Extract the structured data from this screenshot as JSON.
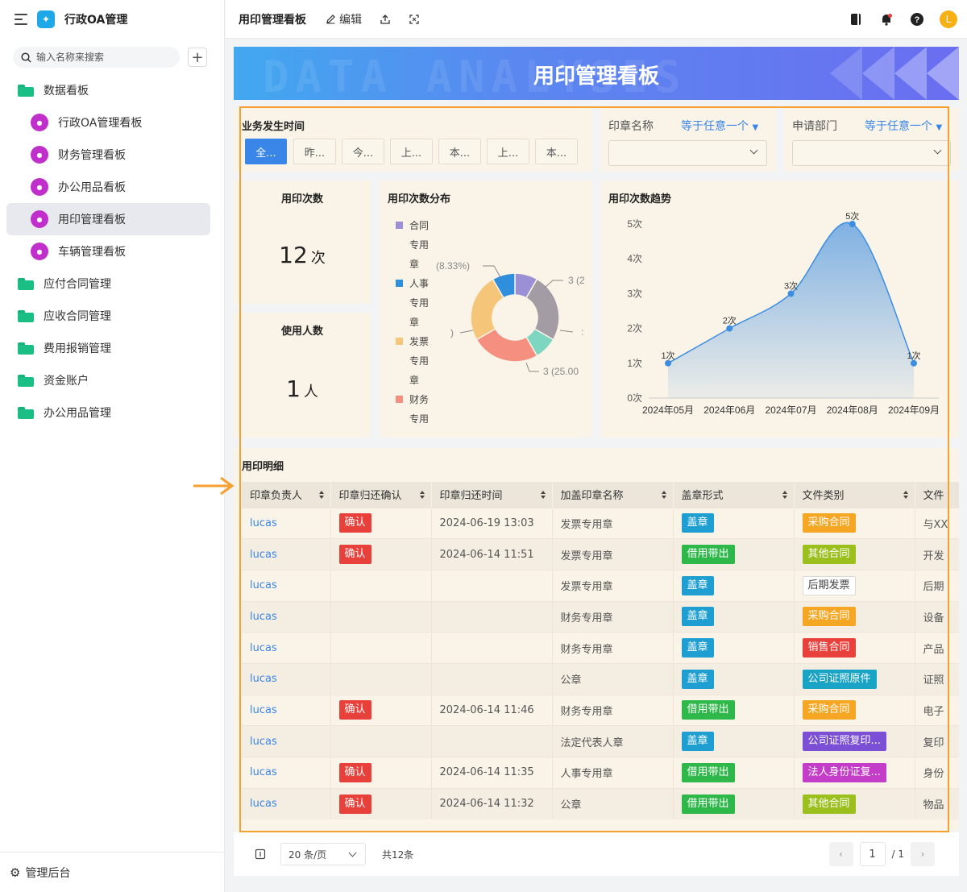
{
  "app": {
    "title": "行政OA管理"
  },
  "sidebar": {
    "search_placeholder": "输入名称来搜索",
    "items": [
      {
        "label": "数据看板",
        "type": "folder",
        "level": 0
      },
      {
        "label": "行政OA管理看板",
        "type": "page",
        "level": 1
      },
      {
        "label": "财务管理看板",
        "type": "page",
        "level": 1
      },
      {
        "label": "办公用品看板",
        "type": "page",
        "level": 1
      },
      {
        "label": "用印管理看板",
        "type": "page",
        "level": 1,
        "active": true
      },
      {
        "label": "车辆管理看板",
        "type": "page",
        "level": 1
      },
      {
        "label": "应付合同管理",
        "type": "folder",
        "level": 0
      },
      {
        "label": "应收合同管理",
        "type": "folder",
        "level": 0
      },
      {
        "label": "费用报销管理",
        "type": "folder",
        "level": 0
      },
      {
        "label": "资金账户",
        "type": "folder",
        "level": 0
      },
      {
        "label": "办公用品管理",
        "type": "folder",
        "level": 0
      }
    ],
    "footer_label": "管理后台"
  },
  "topbar": {
    "page_title": "用印管理看板",
    "edit_label": "编辑",
    "avatar_letter": "L"
  },
  "banner": {
    "title": "用印管理看板",
    "bg_text": "DATA ANALYSIS"
  },
  "filters": {
    "time_title": "业务发生时间",
    "time_buttons": [
      "全...",
      "昨...",
      "今...",
      "上...",
      "本...",
      "上...",
      "本..."
    ],
    "seal_label": "印章名称",
    "seal_op": "等于任意一个",
    "dept_label": "申请部门",
    "dept_op": "等于任意一个"
  },
  "kpi": {
    "count_title": "用印次数",
    "count_value": "12",
    "count_unit": "次",
    "users_title": "使用人数",
    "users_value": "1",
    "users_unit": "人"
  },
  "pie": {
    "title": "用印次数分布",
    "legend": [
      {
        "label": "合同专用章",
        "color": "#9b8fd6"
      },
      {
        "label": "人事专用章",
        "color": "#2f8fdc"
      },
      {
        "label": "发票专用章",
        "color": "#f5c57a"
      },
      {
        "label": "财务专用章",
        "color": "#f58f7f"
      }
    ],
    "labels": {
      "pct_left": "(8.33%)",
      "top_right": "3 (2",
      "right": ":",
      "left": ")",
      "bottom": "3 (25.00"
    }
  },
  "trend": {
    "title": "用印次数趋势"
  },
  "chart_data": {
    "type": "area",
    "title": "用印次数趋势",
    "categories": [
      "2024年05月",
      "2024年06月",
      "2024年07月",
      "2024年08月",
      "2024年09月"
    ],
    "values": [
      1,
      2,
      3,
      5,
      1
    ],
    "value_labels": [
      "1次",
      "2次",
      "3次",
      "5次",
      "1次"
    ],
    "yticks": [
      "0次",
      "1次",
      "2次",
      "3次",
      "4次",
      "5次"
    ],
    "ylim": [
      0,
      5
    ],
    "color": "#3d8de0"
  },
  "pie_data": {
    "type": "pie",
    "slices": [
      {
        "name": "合同专用章",
        "value": 1,
        "color": "#9b8fd6"
      },
      {
        "name": "",
        "value": 3,
        "color": "#a39ca5"
      },
      {
        "name": "",
        "value": 1,
        "color": "#7dd6c0"
      },
      {
        "name": "",
        "value": 3,
        "color": "#f58f7f"
      },
      {
        "name": "发票专用章",
        "value": 3,
        "color": "#f5c57a"
      },
      {
        "name": "人事专用章",
        "value": 1,
        "color": "#2f8fdc"
      }
    ]
  },
  "table": {
    "title": "用印明细",
    "columns": [
      "印章负责人",
      "印章归还确认",
      "印章归还时间",
      "加盖印章名称",
      "盖章形式",
      "文件类别",
      "文件"
    ],
    "rows": [
      {
        "owner": "lucas",
        "confirm": "确认",
        "time": "2024-06-19 13:03",
        "seal": "发票专用章",
        "form": "盖章",
        "form_color": "#1f9fd1",
        "category": "采购合同",
        "cat_color": "#f5a623",
        "file": "与XX"
      },
      {
        "owner": "lucas",
        "confirm": "确认",
        "time": "2024-06-14 11:51",
        "seal": "发票专用章",
        "form": "借用带出",
        "form_color": "#2eb84a",
        "category": "其他合同",
        "cat_color": "#9bbf1c",
        "file": "开发"
      },
      {
        "owner": "lucas",
        "confirm": "",
        "time": "",
        "seal": "发票专用章",
        "form": "盖章",
        "form_color": "#1f9fd1",
        "category": "后期发票",
        "cat_color": "",
        "file": "后期"
      },
      {
        "owner": "lucas",
        "confirm": "",
        "time": "",
        "seal": "财务专用章",
        "form": "盖章",
        "form_color": "#1f9fd1",
        "category": "采购合同",
        "cat_color": "#f5a623",
        "file": "设备"
      },
      {
        "owner": "lucas",
        "confirm": "",
        "time": "",
        "seal": "财务专用章",
        "form": "盖章",
        "form_color": "#1f9fd1",
        "category": "销售合同",
        "cat_color": "#e8403a",
        "file": "产品"
      },
      {
        "owner": "lucas",
        "confirm": "",
        "time": "",
        "seal": "公章",
        "form": "盖章",
        "form_color": "#1f9fd1",
        "category": "公司证照原件",
        "cat_color": "#19a3c4",
        "file": "证照"
      },
      {
        "owner": "lucas",
        "confirm": "确认",
        "time": "2024-06-14 11:46",
        "seal": "财务专用章",
        "form": "借用带出",
        "form_color": "#2eb84a",
        "category": "采购合同",
        "cat_color": "#f5a623",
        "file": "电子"
      },
      {
        "owner": "lucas",
        "confirm": "",
        "time": "",
        "seal": "法定代表人章",
        "form": "盖章",
        "form_color": "#1f9fd1",
        "category": "公司证照复印...",
        "cat_color": "#7b4fd6",
        "file": "复印"
      },
      {
        "owner": "lucas",
        "confirm": "确认",
        "time": "2024-06-14 11:35",
        "seal": "人事专用章",
        "form": "借用带出",
        "form_color": "#2eb84a",
        "category": "法人身份证复...",
        "cat_color": "#c43dc8",
        "file": "身份"
      },
      {
        "owner": "lucas",
        "confirm": "确认",
        "time": "2024-06-14 11:32",
        "seal": "公章",
        "form": "借用带出",
        "form_color": "#2eb84a",
        "category": "其他合同",
        "cat_color": "#9bbf1c",
        "file": "物品"
      }
    ]
  },
  "pager": {
    "page_size": "20 条/页",
    "total": "共12条",
    "current_page": "1",
    "total_pages": "/ 1"
  },
  "colors": {
    "confirm_tag": "#e8403a",
    "accent": "#3a86e8",
    "highlight": "#f5a030"
  }
}
